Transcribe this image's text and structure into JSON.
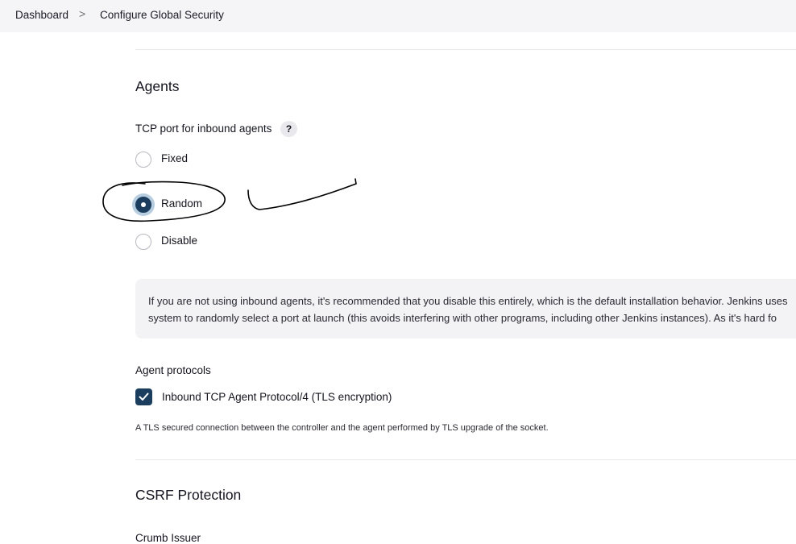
{
  "breadcrumb": {
    "items": [
      {
        "label": "Dashboard"
      },
      {
        "label": "Configure Global Security"
      }
    ],
    "separator": ">"
  },
  "agents": {
    "title": "Agents",
    "tcp_port": {
      "label": "TCP port for inbound agents",
      "help": "?",
      "options": [
        {
          "label": "Fixed",
          "checked": false
        },
        {
          "label": "Random",
          "checked": true
        },
        {
          "label": "Disable",
          "checked": false
        }
      ]
    },
    "info_lines": [
      "If you are not using inbound agents, it's recommended that you disable this entirely, which is the default installation behavior. Jenkins uses",
      "system to randomly select a port at launch (this avoids interfering with other programs, including other Jenkins instances). As it's hard fo"
    ],
    "protocols": {
      "label": "Agent protocols",
      "items": [
        {
          "label": "Inbound TCP Agent Protocol/4 (TLS encryption)",
          "checked": true
        }
      ],
      "description": "A TLS secured connection between the controller and the agent performed by TLS upgrade of the socket."
    }
  },
  "csrf": {
    "title": "CSRF Protection",
    "crumb_issuer_label": "Crumb Issuer"
  },
  "colors": {
    "accent": "#1c3e5e",
    "focus_ring": "#b7cde0",
    "breadcrumb_bg": "#f5f5f7",
    "info_bg": "#f3f3f5",
    "annotation_ink": "#000000"
  }
}
